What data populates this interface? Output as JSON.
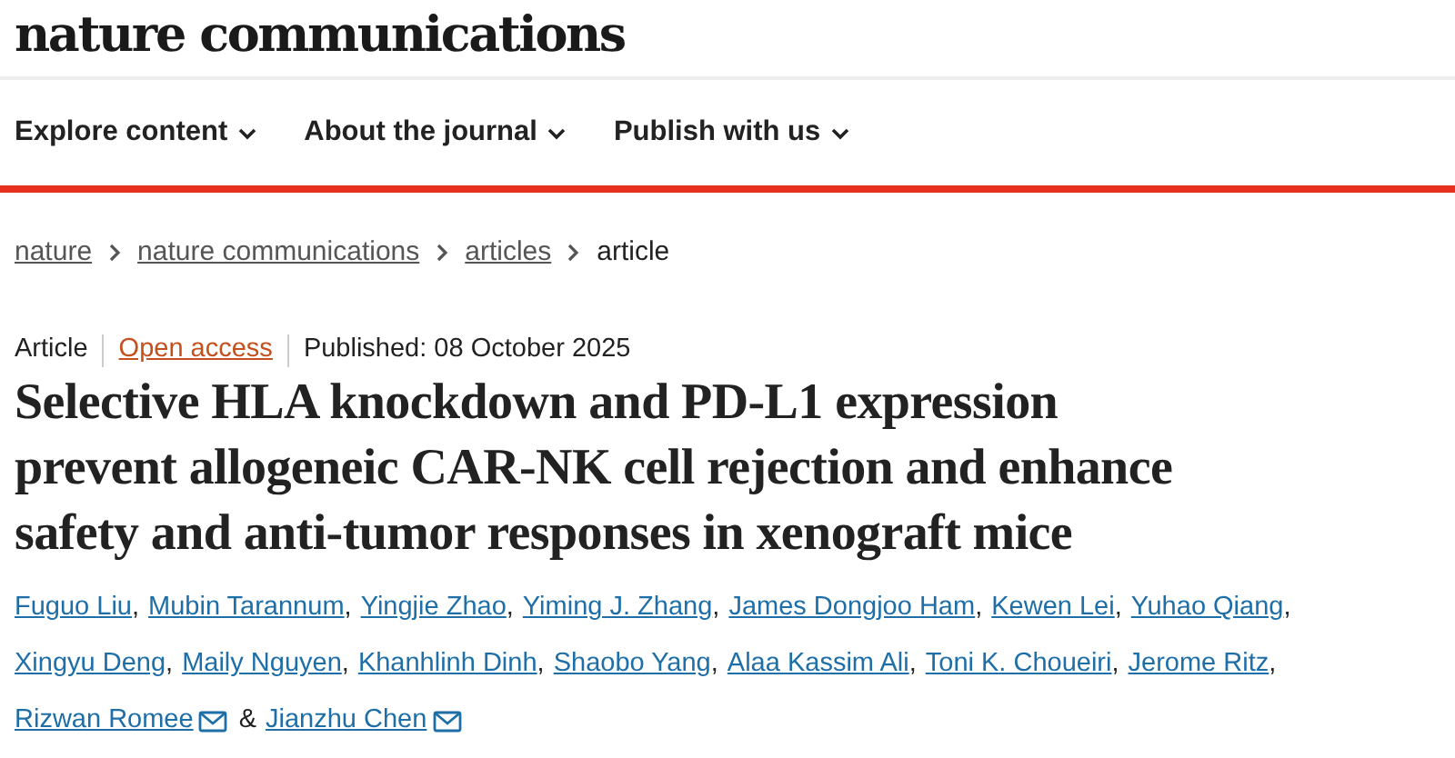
{
  "site": {
    "logo": "nature communications"
  },
  "nav": [
    {
      "label": "Explore content"
    },
    {
      "label": "About the journal"
    },
    {
      "label": "Publish with us"
    }
  ],
  "breadcrumb": [
    {
      "label": "nature",
      "link": true
    },
    {
      "label": "nature communications",
      "link": true
    },
    {
      "label": "articles",
      "link": true
    },
    {
      "label": "article",
      "link": false
    }
  ],
  "meta": {
    "type": "Article",
    "access": "Open access",
    "published": "Published: 08 October 2025"
  },
  "title": "Selective HLA knockdown and PD-L1 expression prevent allogeneic CAR-NK cell rejection and enhance safety and anti-tumor responses in xenograft mice",
  "author_lines": [
    [
      {
        "name": "Fuguo Liu",
        "email": false,
        "sep": ","
      },
      {
        "name": "Mubin Tarannum",
        "email": false,
        "sep": ","
      },
      {
        "name": "Yingjie Zhao",
        "email": false,
        "sep": ","
      },
      {
        "name": "Yiming J. Zhang",
        "email": false,
        "sep": ","
      },
      {
        "name": "James Dongjoo Ham",
        "email": false,
        "sep": ","
      },
      {
        "name": "Kewen Lei",
        "email": false,
        "sep": ","
      },
      {
        "name": "Yuhao Qiang",
        "email": false,
        "sep": ","
      }
    ],
    [
      {
        "name": "Xingyu Deng",
        "email": false,
        "sep": ","
      },
      {
        "name": "Maily Nguyen",
        "email": false,
        "sep": ","
      },
      {
        "name": "Khanhlinh Dinh",
        "email": false,
        "sep": ","
      },
      {
        "name": "Shaobo Yang",
        "email": false,
        "sep": ","
      },
      {
        "name": "Alaa Kassim Ali",
        "email": false,
        "sep": ","
      },
      {
        "name": "Toni K. Choueiri",
        "email": false,
        "sep": ","
      },
      {
        "name": "Jerome Ritz",
        "email": false,
        "sep": ","
      }
    ],
    [
      {
        "name": "Rizwan Romee",
        "email": true,
        "sep": "&"
      },
      {
        "name": "Jianzhu Chen",
        "email": true
      }
    ]
  ]
}
